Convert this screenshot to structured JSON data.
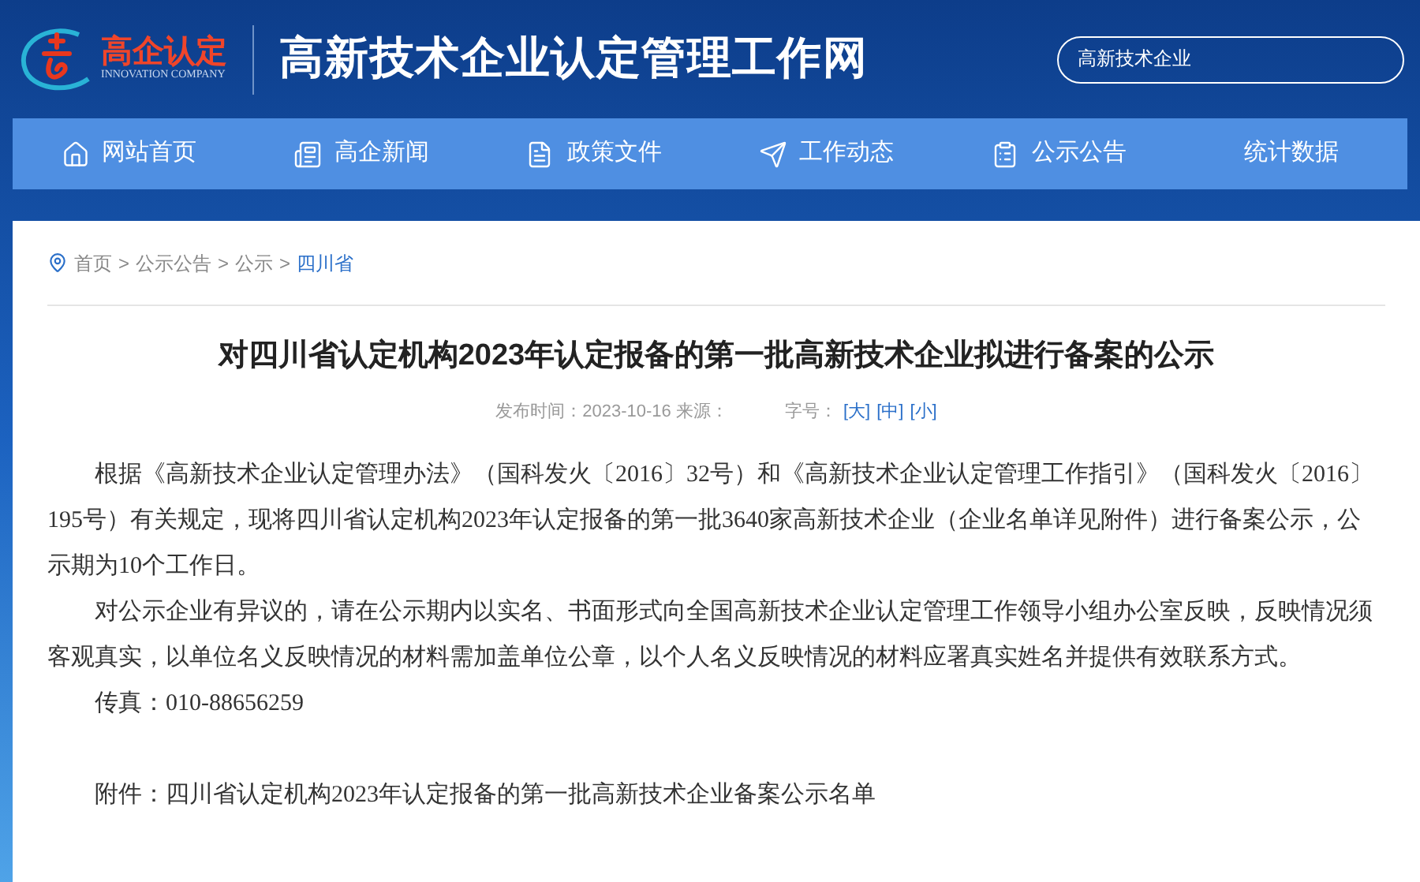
{
  "header": {
    "logo_text": "高企认定",
    "logo_subtext": "INNOVATION COMPANY",
    "site_title": "高新技术企业认定管理工作网",
    "search": {
      "value": "高新技术企业"
    }
  },
  "nav": [
    {
      "label": "网站首页"
    },
    {
      "label": "高企新闻"
    },
    {
      "label": "政策文件"
    },
    {
      "label": "工作动态"
    },
    {
      "label": "公示公告"
    },
    {
      "label": "统计数据"
    }
  ],
  "breadcrumb": [
    {
      "label": "首页",
      "selected": false
    },
    {
      "label": "公示公告",
      "selected": false
    },
    {
      "label": "公示",
      "selected": false
    },
    {
      "label": "四川省",
      "selected": true
    }
  ],
  "breadcrumb_separator": ">",
  "article": {
    "title": "对四川省认定机构2023年认定报备的第一批高新技术企业拟进行备案的公示",
    "meta": "发布时间：2023-10-16 来源：",
    "font_size_label": "字号：",
    "font_sizes": [
      {
        "label": "[大]",
        "selected": false
      },
      {
        "label": "[中]",
        "selected": false
      },
      {
        "label": "[小]",
        "selected": false
      }
    ],
    "paragraphs": [
      "根据《高新技术企业认定管理办法》（国科发火〔2016〕32号）和《高新技术企业认定管理工作指引》（国科发火〔2016〕195号）有关规定，现将四川省认定机构2023年认定报备的第一批3640家高新技术企业（企业名单详见附件）进行备案公示，公示期为10个工作日。",
      "对公示企业有异议的，请在公示期内以实名、书面形式向全国高新技术企业认定管理工作领导小组办公室反映，反映情况须客观真实，以单位名义反映情况的材料需加盖单位公章，以个人名义反映情况的材料应署真实姓名并提供有效联系方式。",
      "传真：010-88656259"
    ],
    "attachment": "附件：四川省认定机构2023年认定报备的第一批高新技术企业备案公示名单"
  }
}
